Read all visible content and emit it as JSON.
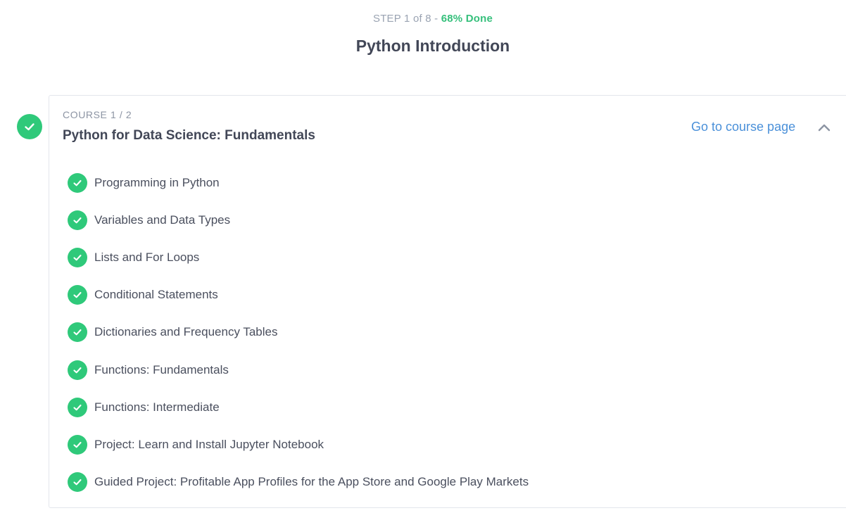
{
  "header": {
    "step_text": "STEP 1 of 8 - ",
    "progress_text": "68% Done",
    "title": "Python Introduction"
  },
  "course": {
    "label": "COURSE 1 / 2",
    "title": "Python for Data Science: Fundamentals",
    "link_text": "Go to course page",
    "completed": true,
    "expanded": true,
    "lessons": [
      {
        "label": "Programming in Python",
        "completed": true
      },
      {
        "label": "Variables and Data Types",
        "completed": true
      },
      {
        "label": "Lists and For Loops",
        "completed": true
      },
      {
        "label": "Conditional Statements",
        "completed": true
      },
      {
        "label": "Dictionaries and Frequency Tables",
        "completed": true
      },
      {
        "label": "Functions: Fundamentals",
        "completed": true
      },
      {
        "label": "Functions: Intermediate",
        "completed": true
      },
      {
        "label": "Project: Learn and Install Jupyter Notebook",
        "completed": true
      },
      {
        "label": "Guided Project: Profitable App Profiles for the App Store and Google Play Markets",
        "completed": true
      }
    ]
  },
  "icons": {
    "course_status": "check-circle-icon",
    "lesson_status": "check-circle-icon",
    "collapse": "chevron-up-icon"
  },
  "colors": {
    "accent_green": "#2fc97a",
    "progress_green": "#36c07c",
    "link_blue": "#4a90d9",
    "text_dark": "#424757",
    "text_muted": "#9aa3b2"
  }
}
